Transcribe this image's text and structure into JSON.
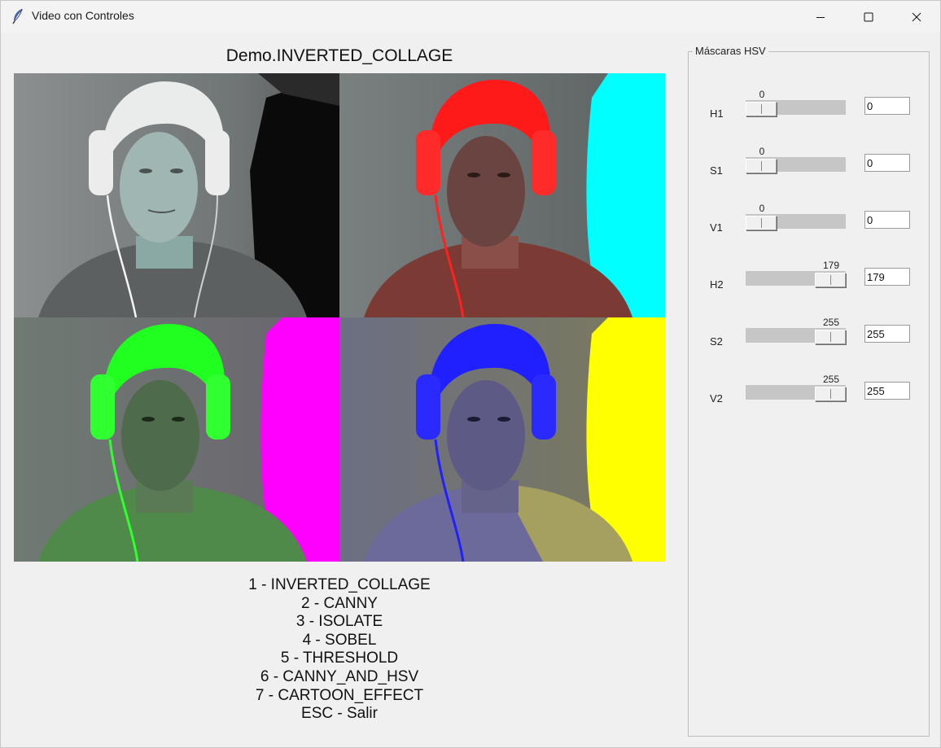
{
  "window": {
    "title": "Video con Controles",
    "icon": "feather-icon"
  },
  "video": {
    "title": "Demo.INVERTED_COLLAGE",
    "quadrant_tints": [
      "#cfd8d6",
      "#ff2020",
      "#22ff22",
      "#2222ff"
    ]
  },
  "menu": [
    "1 - INVERTED_COLLAGE",
    "2 - CANNY",
    "3 - ISOLATE",
    "4 - SOBEL",
    "5 - THRESHOLD",
    "6 - CANNY_AND_HSV",
    "7 - CARTOON_EFFECT",
    "ESC - Salir"
  ],
  "panel": {
    "title": "Máscaras HSV",
    "sliders": [
      {
        "label": "H1",
        "value": "0",
        "entry": "0",
        "min": 0,
        "max": 179
      },
      {
        "label": "S1",
        "value": "0",
        "entry": "0",
        "min": 0,
        "max": 255
      },
      {
        "label": "V1",
        "value": "0",
        "entry": "0",
        "min": 0,
        "max": 255
      },
      {
        "label": "H2",
        "value": "179",
        "entry": "179",
        "min": 0,
        "max": 179
      },
      {
        "label": "S2",
        "value": "255",
        "entry": "255",
        "min": 0,
        "max": 255
      },
      {
        "label": "V2",
        "value": "255",
        "entry": "255",
        "min": 0,
        "max": 255
      }
    ]
  }
}
